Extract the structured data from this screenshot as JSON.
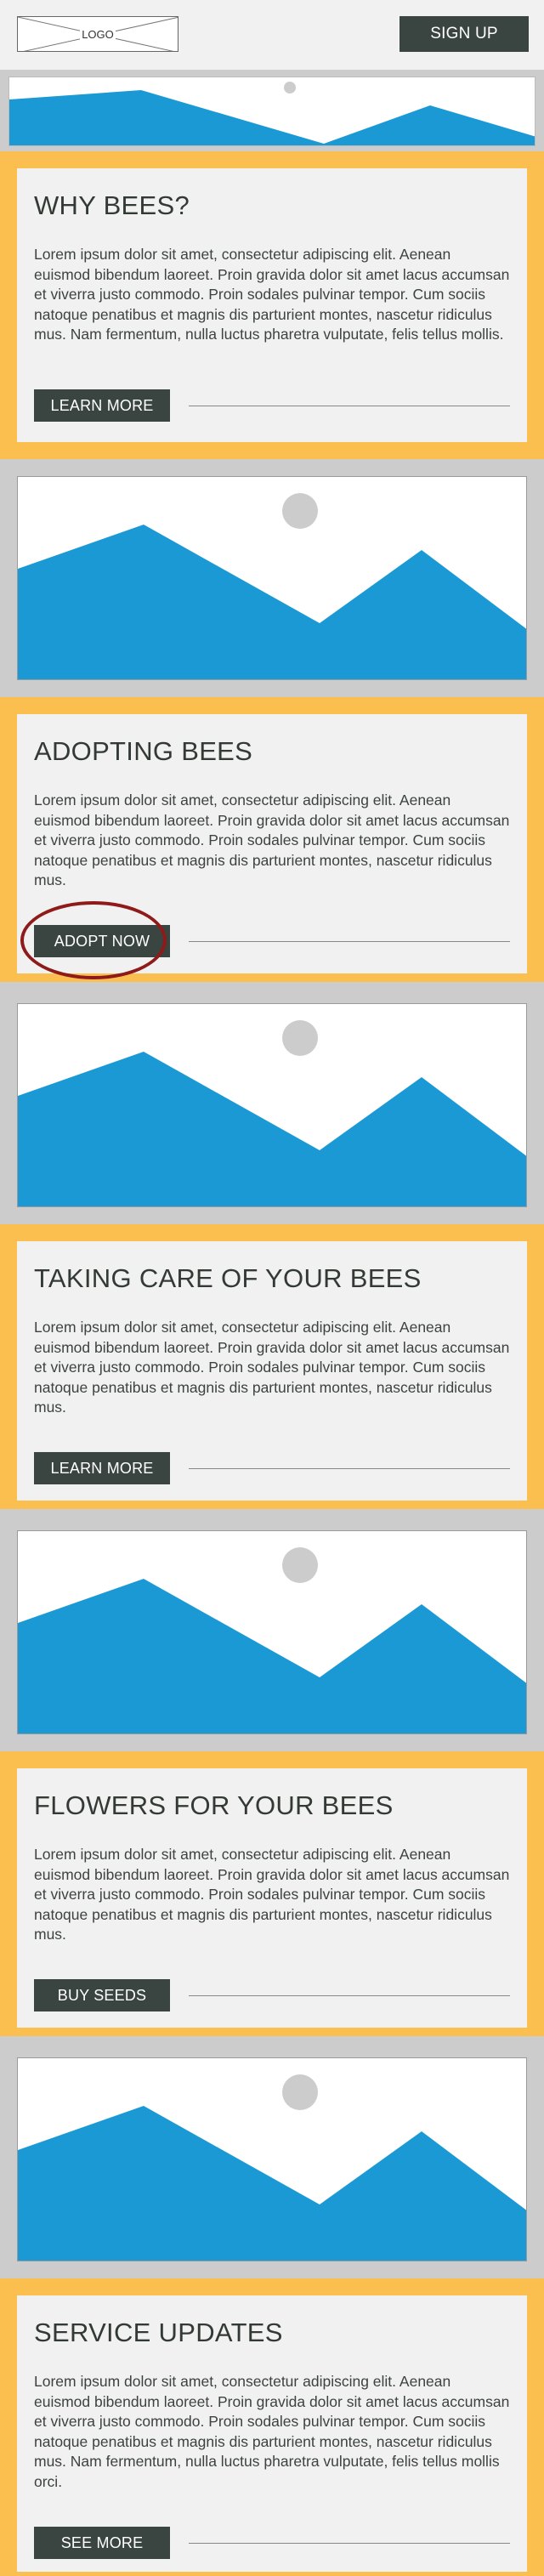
{
  "header": {
    "logo_text": "LOGO",
    "signup_label": "SIGN UP"
  },
  "colors": {
    "accent": "#fbbf4f",
    "button": "#3a4541",
    "image_fill": "#1b99d4",
    "sun": "#cccccc"
  },
  "sections": [
    {
      "title": "WHY BEES?",
      "body": "Lorem ipsum dolor sit amet, consectetur adipiscing elit. Aenean euismod bibendum laoreet. Proin gravida dolor sit amet lacus accumsan et viverra justo commodo. Proin sodales pulvinar tempor. Cum sociis natoque penatibus et magnis dis parturient montes, nascetur ridiculus mus. Nam fermentum, nulla luctus pharetra vulputate, felis tellus mollis.",
      "button": "LEARN MORE"
    },
    {
      "title": "ADOPTING BEES",
      "body": "Lorem ipsum dolor sit amet, consectetur adipiscing elit. Aenean euismod bibendum laoreet. Proin gravida dolor sit amet lacus accumsan et viverra justo commodo. Proin sodales pulvinar tempor. Cum sociis natoque penatibus et magnis dis parturient montes, nascetur ridiculus mus.",
      "button": "ADOPT NOW"
    },
    {
      "title": "TAKING CARE OF YOUR BEES",
      "body": "Lorem ipsum dolor sit amet, consectetur adipiscing elit. Aenean euismod bibendum laoreet. Proin gravida dolor sit amet lacus accumsan et viverra justo commodo. Proin sodales pulvinar tempor. Cum sociis natoque penatibus et magnis dis parturient montes, nascetur ridiculus mus.",
      "button": "LEARN MORE"
    },
    {
      "title": "FLOWERS FOR YOUR BEES",
      "body": "Lorem ipsum dolor sit amet, consectetur adipiscing elit. Aenean euismod bibendum laoreet. Proin gravida dolor sit amet lacus accumsan et viverra justo commodo. Proin sodales pulvinar tempor. Cum sociis natoque penatibus et magnis dis parturient montes, nascetur ridiculus mus.",
      "button": "BUY SEEDS"
    },
    {
      "title": "SERVICE UPDATES",
      "body": "Lorem ipsum dolor sit amet, consectetur adipiscing elit. Aenean euismod bibendum laoreet. Proin gravida dolor sit amet lacus accumsan et viverra justo commodo. Proin sodales pulvinar tempor. Cum sociis natoque penatibus et magnis dis parturient montes, nascetur ridiculus mus. Nam fermentum, nulla luctus pharetra vulputate, felis tellus mollis orci.",
      "button": "SEE MORE"
    }
  ]
}
